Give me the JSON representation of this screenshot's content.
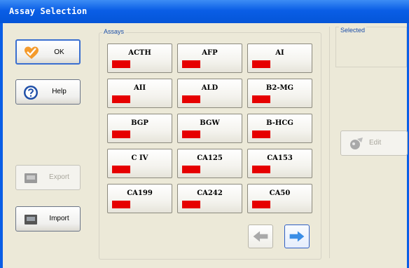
{
  "window": {
    "title": "Assay Selection"
  },
  "buttons": {
    "ok": "OK",
    "help": "Help",
    "export": "Export",
    "import": "Import",
    "edit": "Edit"
  },
  "groups": {
    "assays_label": "Assays",
    "selected_label": "Selected"
  },
  "assay_indicator_color": "#e60000",
  "assays": [
    "ACTH",
    "AFP",
    "AI",
    "AII",
    "ALD",
    "B2-MG",
    "BGP",
    "BGW",
    "B-HCG",
    "C IV",
    "CA125",
    "CA153",
    "CA199",
    "CA242",
    "CA50"
  ],
  "icons": {
    "ok": "heart-check-icon",
    "help": "help-question-icon",
    "export": "export-disk-icon",
    "import": "import-disk-icon",
    "edit": "edit-paint-icon",
    "prev": "arrow-left-icon",
    "next": "arrow-right-icon"
  },
  "nav": {
    "prev_enabled": false,
    "next_enabled": true
  }
}
